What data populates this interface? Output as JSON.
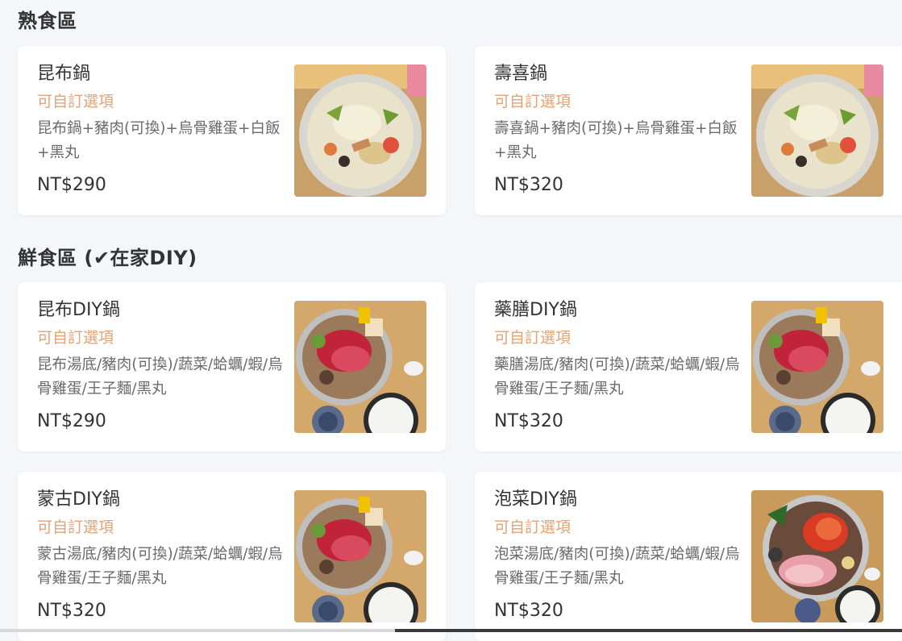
{
  "sections": [
    {
      "title": "熟食區",
      "items": [
        {
          "name": "昆布鍋",
          "options": "可自訂選項",
          "desc": "昆布鍋+豬肉(可換)+烏骨雞蛋+白飯+黑丸",
          "price": "NT$290"
        },
        {
          "name": "壽喜鍋",
          "options": "可自訂選項",
          "desc": "壽喜鍋+豬肉(可換)+烏骨雞蛋+白飯+黑丸",
          "price": "NT$320"
        }
      ]
    },
    {
      "title": "鮮食區 (✔在家DIY)",
      "items": [
        {
          "name": "昆布DIY鍋",
          "options": "可自訂選項",
          "desc": "昆布湯底/豬肉(可換)/蔬菜/蛤蠣/蝦/烏骨雞蛋/王子麵/黑丸",
          "price": "NT$290"
        },
        {
          "name": "藥膳DIY鍋",
          "options": "可自訂選項",
          "desc": "藥膳湯底/豬肉(可換)/蔬菜/蛤蠣/蝦/烏骨雞蛋/王子麵/黑丸",
          "price": "NT$320"
        },
        {
          "name": "蒙古DIY鍋",
          "options": "可自訂選項",
          "desc": "蒙古湯底/豬肉(可換)/蔬菜/蛤蠣/蝦/烏骨雞蛋/王子麵/黑丸",
          "price": "NT$320"
        },
        {
          "name": "泡菜DIY鍋",
          "options": "可自訂選項",
          "desc": "泡菜湯底/豬肉(可換)/蔬菜/蛤蠣/蝦/烏骨雞蛋/王子麵/黑丸",
          "price": "NT$320"
        }
      ]
    }
  ],
  "colors": {
    "background": "#f5f6fa",
    "card": "#ffffff",
    "options_accent": "#e6a273",
    "text": "#333333",
    "desc_text": "#6b6b6b"
  }
}
